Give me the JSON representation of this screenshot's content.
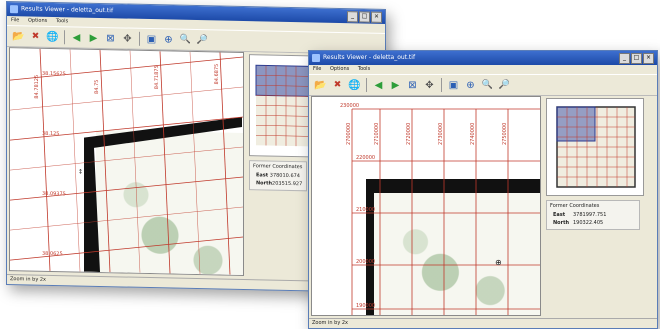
{
  "windows": [
    {
      "title": "Results Viewer - deletta_out.tif",
      "menu": [
        "File",
        "Options",
        "Tools"
      ],
      "status": "Zoom in by 2x",
      "coords": {
        "header": "Former Coordinates",
        "east_label": "East",
        "east_value": "378010.674",
        "north_label": "North",
        "north_value": "203515.927"
      },
      "grid_labels": [
        "38.15625",
        "38.125",
        "38.09375",
        "38.0625",
        "84.78125",
        "84.75",
        "84.71875",
        "84.6875"
      ]
    },
    {
      "title": "Results Viewer - deletta_out.tif",
      "menu": [
        "File",
        "Options",
        "Tools"
      ],
      "status": "Zoom in by 2x",
      "coords": {
        "header": "Former Coordinates",
        "east_label": "East",
        "east_value": "3781997.751",
        "north_label": "North",
        "north_value": "190322.405"
      },
      "grid_labels": [
        "230000",
        "220000",
        "210000",
        "200000",
        "190000",
        "2700000",
        "2710000",
        "2720000",
        "2730000",
        "2740000",
        "2750000"
      ]
    }
  ],
  "window_controls": [
    "_",
    "□",
    "×"
  ],
  "toolbar_icons": [
    {
      "name": "open-folder-icon",
      "glyph": "📂"
    },
    {
      "name": "close-file-icon",
      "glyph": "✖"
    },
    {
      "name": "globe-icon",
      "glyph": "🌐"
    },
    {
      "name": "back-arrow-icon",
      "glyph": "◀"
    },
    {
      "name": "forward-arrow-icon",
      "glyph": "▶"
    },
    {
      "name": "zoom-extent-icon",
      "glyph": "⊠"
    },
    {
      "name": "pan-icon",
      "glyph": "✥"
    },
    {
      "name": "full-view-icon",
      "glyph": "▣"
    },
    {
      "name": "zoom-window-icon",
      "glyph": "⊕"
    },
    {
      "name": "zoom-in-icon",
      "glyph": "🔍"
    },
    {
      "name": "zoom-out-icon",
      "glyph": "🔎"
    }
  ],
  "colors": {
    "title_bar": "#1d4aa8",
    "grid_line": "#c0392b",
    "overview_rect": "#3a4fa8"
  }
}
